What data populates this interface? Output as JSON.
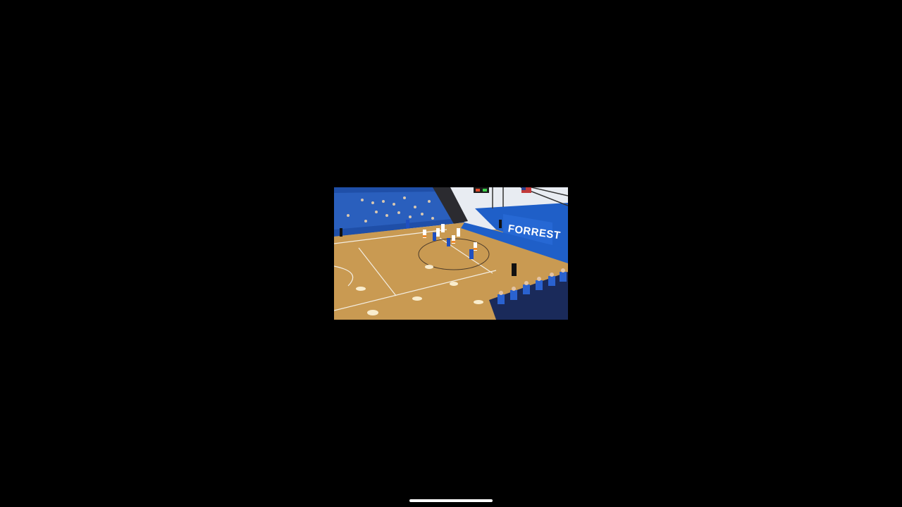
{
  "video": {
    "wall_banner_text": "FORREST",
    "content": "basketball-game-broadcast"
  },
  "colors": {
    "background": "#000000",
    "court_wood": "#c99a52",
    "team_blue": "#1f5fc8",
    "wall_white": "#e8ecf2",
    "home_indicator": "#ffffff"
  },
  "home_indicator": {
    "icon": "home-indicator-bar"
  }
}
